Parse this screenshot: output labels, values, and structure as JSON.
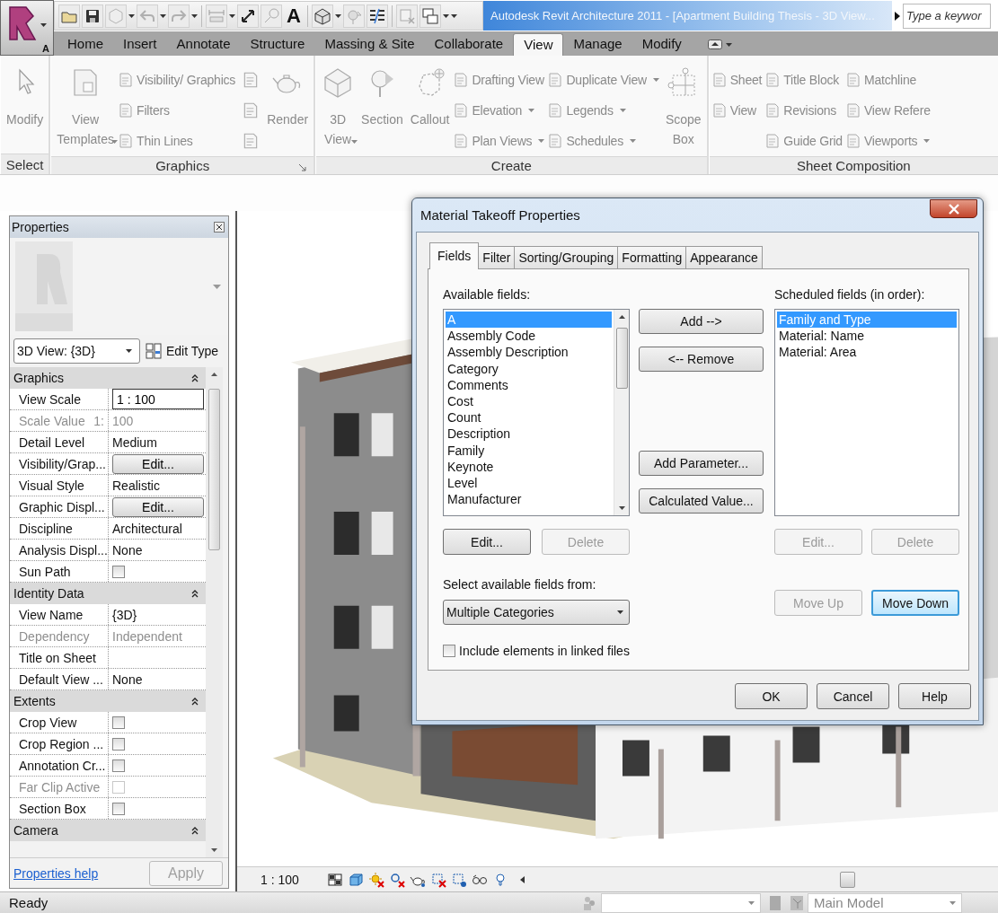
{
  "app_button": {
    "label": "A"
  },
  "quick_access": {
    "text_tool": "A"
  },
  "title_bar": {
    "title": "Autodesk Revit Architecture 2011 - [Apartment Building Thesis - 3D View...",
    "search": {
      "placeholder": "Type a keywor"
    }
  },
  "ribbon_tabs": [
    {
      "label": "Home",
      "selected": false
    },
    {
      "label": "Insert",
      "selected": false
    },
    {
      "label": "Annotate",
      "selected": false
    },
    {
      "label": "Structure",
      "selected": false
    },
    {
      "label": "Massing & Site",
      "selected": false
    },
    {
      "label": "Collaborate",
      "selected": false
    },
    {
      "label": "View",
      "selected": true
    },
    {
      "label": "Manage",
      "selected": false
    },
    {
      "label": "Modify",
      "selected": false
    }
  ],
  "ribbon_panels": [
    {
      "title": "Select",
      "launcher": false,
      "groups": [
        {
          "kind": "large",
          "label": "Modify",
          "dropdown": false
        }
      ]
    },
    {
      "title": "Graphics",
      "launcher": true,
      "groups": [
        {
          "kind": "large",
          "label": "View\nTemplates",
          "dropdown": true
        },
        {
          "kind": "stack",
          "items": [
            {
              "label": "Visibility/ Graphics",
              "dropdown": false
            },
            {
              "label": "Filters",
              "dropdown": false
            },
            {
              "label": "Thin Lines",
              "dropdown": false
            }
          ]
        },
        {
          "kind": "icons"
        },
        {
          "kind": "large",
          "label": "Render",
          "dropdown": false
        }
      ]
    },
    {
      "title": "Create",
      "launcher": false,
      "groups": [
        {
          "kind": "large",
          "label": "3D\nView",
          "dropdown": true
        },
        {
          "kind": "large",
          "label": "Section",
          "dropdown": false
        },
        {
          "kind": "large",
          "label": "Callout",
          "dropdown": false
        },
        {
          "kind": "stack",
          "items": [
            {
              "label": "Drafting View",
              "dropdown": false
            },
            {
              "label": "Elevation",
              "dropdown": true
            },
            {
              "label": "Plan Views",
              "dropdown": true
            }
          ]
        },
        {
          "kind": "stack",
          "items": [
            {
              "label": "Duplicate View",
              "dropdown": true
            },
            {
              "label": "Legends",
              "dropdown": true
            },
            {
              "label": "Schedules",
              "dropdown": true
            }
          ]
        },
        {
          "kind": "large",
          "label": "Scope\nBox",
          "dropdown": false
        }
      ]
    },
    {
      "title": "Sheet Composition",
      "launcher": false,
      "groups": [
        {
          "kind": "stack",
          "items": [
            {
              "label": "Sheet",
              "dropdown": false
            },
            {
              "label": "View",
              "dropdown": false
            }
          ]
        },
        {
          "kind": "stack",
          "items": [
            {
              "label": "Title Block",
              "dropdown": false
            },
            {
              "label": "Revisions",
              "dropdown": false
            },
            {
              "label": "Guide Grid",
              "dropdown": false
            }
          ]
        },
        {
          "kind": "stack",
          "items": [
            {
              "label": "Matchline",
              "dropdown": false
            },
            {
              "label": "View Refere",
              "dropdown": false
            },
            {
              "label": "Viewports",
              "dropdown": true
            }
          ]
        }
      ]
    }
  ],
  "properties": {
    "title": "Properties",
    "type_selector": "3D View: {3D}",
    "edit_type": "Edit Type",
    "groups": [
      {
        "name": "Graphics",
        "expanded": true,
        "rows": [
          {
            "label": "View Scale",
            "kind": "input",
            "value": "1 : 100",
            "disabled": false
          },
          {
            "label": "Scale Value",
            "label_suffix": "1:",
            "kind": "text",
            "value": "100",
            "disabled": true
          },
          {
            "label": "Detail Level",
            "kind": "text",
            "value": "Medium",
            "disabled": false
          },
          {
            "label": "Visibility/Grap...",
            "kind": "button",
            "value": "Edit...",
            "disabled": false
          },
          {
            "label": "Visual Style",
            "kind": "text",
            "value": "Realistic",
            "disabled": false
          },
          {
            "label": "Graphic Displ...",
            "kind": "button",
            "value": "Edit...",
            "disabled": false
          },
          {
            "label": "Discipline",
            "kind": "text",
            "value": "Architectural",
            "disabled": false
          },
          {
            "label": "Analysis Displ...",
            "kind": "text",
            "value": "None",
            "disabled": false
          },
          {
            "label": "Sun Path",
            "kind": "checkbox",
            "checked": false,
            "disabled": false
          }
        ]
      },
      {
        "name": "Identity Data",
        "expanded": true,
        "rows": [
          {
            "label": "View Name",
            "kind": "text",
            "value": "{3D}",
            "disabled": false
          },
          {
            "label": "Dependency",
            "kind": "text",
            "value": "Independent",
            "disabled": true
          },
          {
            "label": "Title on Sheet",
            "kind": "text",
            "disabled": false
          },
          {
            "label": "Default View ...",
            "kind": "text",
            "value": "None",
            "disabled": false
          }
        ]
      },
      {
        "name": "Extents",
        "expanded": true,
        "rows": [
          {
            "label": "Crop View",
            "kind": "checkbox",
            "checked": false,
            "disabled": false
          },
          {
            "label": "Crop Region ...",
            "kind": "checkbox",
            "checked": false,
            "disabled": false
          },
          {
            "label": "Annotation Cr...",
            "kind": "checkbox",
            "checked": false,
            "disabled": false
          },
          {
            "label": "Far Clip Active",
            "kind": "checkbox",
            "checked": false,
            "disabled": true
          },
          {
            "label": "Section Box",
            "kind": "checkbox",
            "checked": false,
            "disabled": false
          }
        ]
      },
      {
        "name": "Camera",
        "expanded": true
      }
    ],
    "help_link": "Properties help",
    "apply": {
      "label": "Apply",
      "disabled": true
    }
  },
  "view_bar": {
    "scale": "1 : 100"
  },
  "status_bar": {
    "text": "Ready",
    "design_option": "Main Model"
  },
  "dialog": {
    "title": "Material Takeoff Properties",
    "tabs": [
      {
        "label": "Fields",
        "selected": true
      },
      {
        "label": "Filter",
        "selected": false
      },
      {
        "label": "Sorting/Grouping",
        "selected": false
      },
      {
        "label": "Formatting",
        "selected": false
      },
      {
        "label": "Appearance",
        "selected": false
      }
    ],
    "available": {
      "label": "Available fields:",
      "items": [
        {
          "label": "A",
          "selected": true
        },
        {
          "label": "Assembly Code",
          "selected": false
        },
        {
          "label": "Assembly Description",
          "selected": false
        },
        {
          "label": "Category",
          "selected": false
        },
        {
          "label": "Comments",
          "selected": false
        },
        {
          "label": "Cost",
          "selected": false
        },
        {
          "label": "Count",
          "selected": false
        },
        {
          "label": "Description",
          "selected": false
        },
        {
          "label": "Family",
          "selected": false
        },
        {
          "label": "Keynote",
          "selected": false
        },
        {
          "label": "Level",
          "selected": false
        },
        {
          "label": "Manufacturer",
          "selected": false
        }
      ],
      "buttons": [
        {
          "label": "Edit...",
          "disabled": false
        },
        {
          "label": "Delete",
          "disabled": true
        }
      ]
    },
    "transfer_buttons": [
      {
        "label": "Add -->",
        "disabled": false
      },
      {
        "label": "<-- Remove",
        "disabled": false
      }
    ],
    "parameter_buttons": [
      {
        "label": "Add Parameter...",
        "disabled": false
      },
      {
        "label": "Calculated Value...",
        "disabled": false
      }
    ],
    "scheduled": {
      "label": "Scheduled fields (in order):",
      "items": [
        {
          "label": "Family and Type",
          "selected": true
        },
        {
          "label": "Material: Name",
          "selected": false
        },
        {
          "label": "Material: Area",
          "selected": false
        }
      ],
      "buttons": [
        {
          "label": "Edit...",
          "disabled": true
        },
        {
          "label": "Delete",
          "disabled": true
        }
      ]
    },
    "source": {
      "label": "Select available fields from:",
      "value": "Multiple Categories"
    },
    "order_buttons": [
      {
        "label": "Move Up",
        "disabled": true,
        "focused": false
      },
      {
        "label": "Move Down",
        "disabled": false,
        "focused": true
      }
    ],
    "include_linked": {
      "label": "Include elements in linked files",
      "checked": false
    },
    "footer_buttons": [
      {
        "label": "OK",
        "disabled": false
      },
      {
        "label": "Cancel",
        "disabled": false
      },
      {
        "label": "Help",
        "disabled": false
      }
    ]
  }
}
